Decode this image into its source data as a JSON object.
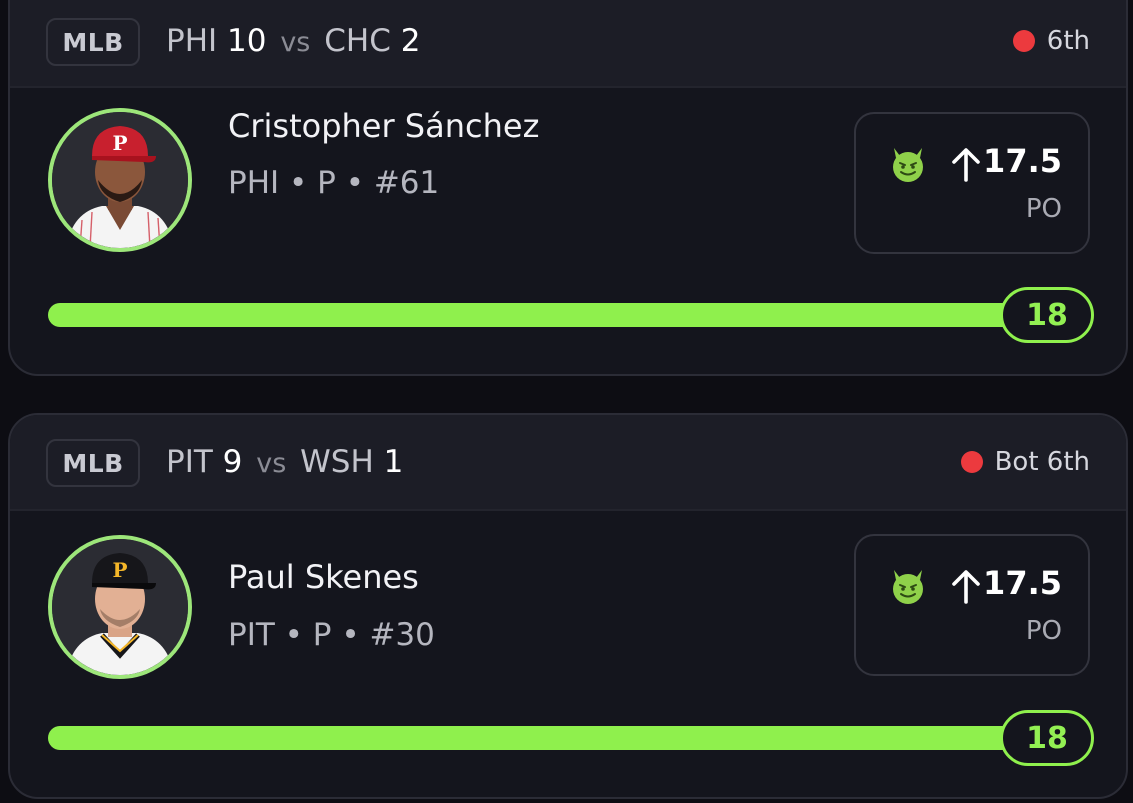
{
  "cards": [
    {
      "league": "MLB",
      "home_team": "PHI",
      "home_score": "10",
      "vs": "vs",
      "away_team": "CHC",
      "away_score": "2",
      "status": "6th",
      "player_name": "Cristopher Sánchez",
      "player_meta": "PHI • P • #61",
      "line_direction_icon": "arrow-up-icon",
      "line_value": "17.5",
      "stat": "PO",
      "current_value": "18",
      "progress_fraction": 1.0,
      "cap_color": "#c8202e",
      "cap_logo": "P",
      "jersey_color": "#f4f4f4",
      "jersey_stripe": "#c8202e"
    },
    {
      "league": "MLB",
      "home_team": "PIT",
      "home_score": "9",
      "vs": "vs",
      "away_team": "WSH",
      "away_score": "1",
      "status": "Bot 6th",
      "player_name": "Paul Skenes",
      "player_meta": "PIT • P • #30",
      "line_direction_icon": "arrow-up-icon",
      "line_value": "17.5",
      "stat": "PO",
      "current_value": "18",
      "progress_fraction": 1.0,
      "cap_color": "#16161a",
      "cap_logo": "P",
      "jersey_color": "#f4f4f4",
      "jersey_stripe": "#f5b729"
    }
  ],
  "colors": {
    "accent_green": "#8ff04d",
    "live_red": "#ec3a3e",
    "avatar_ring": "#9de67a"
  }
}
